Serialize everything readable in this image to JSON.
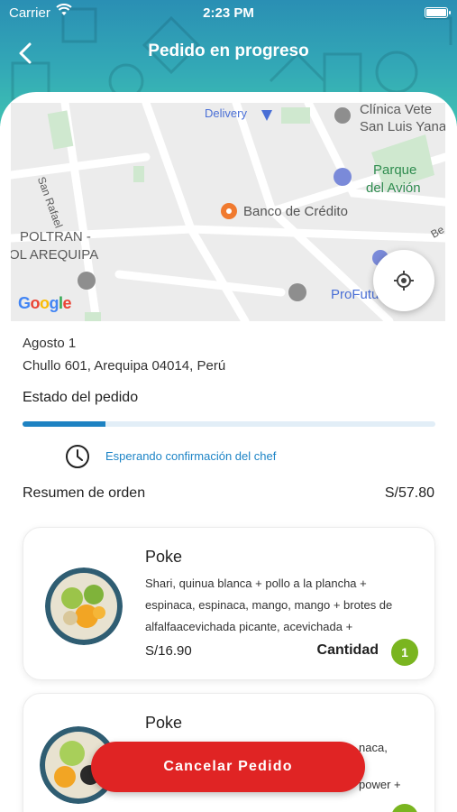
{
  "status_bar": {
    "carrier": "Carrier",
    "time": "2:23 PM"
  },
  "header": {
    "title": "Pedido en progreso"
  },
  "map": {
    "labels": {
      "delivery": "Delivery",
      "clinica": "Clínica Vete",
      "san_luis": "San Luis Yana",
      "san_rafael": "San Rafael",
      "parque": "Parque",
      "del_avion": "del Avión",
      "banco": "Banco de Crédito",
      "poltran": "POLTRAN -",
      "arequipa": "OL AREQUIPA",
      "profutu": "ProFutu",
      "be": "Be",
      "google": [
        "G",
        "o",
        "o",
        "g",
        "l",
        "e"
      ]
    }
  },
  "order": {
    "date": "Agosto 1",
    "address": "Chullo 601, Arequipa 04014, Perú",
    "status_title": "Estado del pedido",
    "progress": 0.2,
    "status_text": "Esperando confirmación del chef",
    "summary_label": "Resumen de orden",
    "summary_total": "S/57.80"
  },
  "items": [
    {
      "name": "Poke",
      "description": "Shari, quinua blanca + pollo a la plancha + espinaca, espinaca, mango, mango + brotes de alfalfaacevichada picante, acevichada +",
      "price": "S/16.90",
      "qty_label": "Cantidad",
      "qty": "1"
    },
    {
      "name": "Poke",
      "description": "",
      "price": "",
      "qty_label": "",
      "qty": ""
    }
  ],
  "fragments": {
    "card2_line1": "naca,",
    "card2_line2": "power +"
  },
  "actions": {
    "cancel": "Cancelar Pedido"
  },
  "colors": {
    "accent": "#1e82c2",
    "qty_badge": "#7ab520",
    "cancel": "#e02424",
    "header_gradient": [
      "#2a8fb4",
      "#3fc2b2"
    ]
  }
}
